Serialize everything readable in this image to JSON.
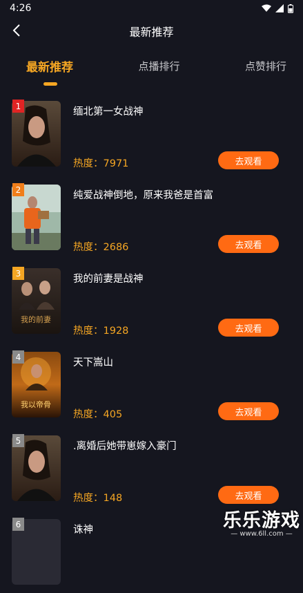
{
  "status": {
    "time": "4:26"
  },
  "nav": {
    "title": "最新推荐"
  },
  "tabs": [
    {
      "label": "最新推荐",
      "active": true
    },
    {
      "label": "点播排行",
      "active": false
    },
    {
      "label": "点赞排行",
      "active": false
    }
  ],
  "colors": {
    "accent": "#f5a623",
    "button": "#ff6a13",
    "background": "#15161f",
    "rank_1": "#e02424",
    "rank_2": "#f07e1a",
    "rank_3": "#f5a623",
    "rank_other": "#8a8a8a"
  },
  "items": [
    {
      "rank": "1",
      "title": "缅北第一女战神",
      "heat": "热度：7971",
      "button": "去观看"
    },
    {
      "rank": "2",
      "title": "纯爱战神倒地，原来我爸是首富",
      "heat": "热度：2686",
      "button": "去观看"
    },
    {
      "rank": "3",
      "title": "我的前妻是战神",
      "heat": "热度：1928",
      "button": "去观看"
    },
    {
      "rank": "4",
      "title": "天下嵩山",
      "heat": "热度：405",
      "button": "去观看"
    },
    {
      "rank": "5",
      "title": ".离婚后她带崽嫁入豪门",
      "heat": "热度：148",
      "button": "去观看"
    },
    {
      "rank": "6",
      "title": "诛神",
      "heat": "",
      "button": ""
    }
  ],
  "watermark": {
    "main": "乐乐游戏",
    "sub": "— www.6ll.com —"
  }
}
